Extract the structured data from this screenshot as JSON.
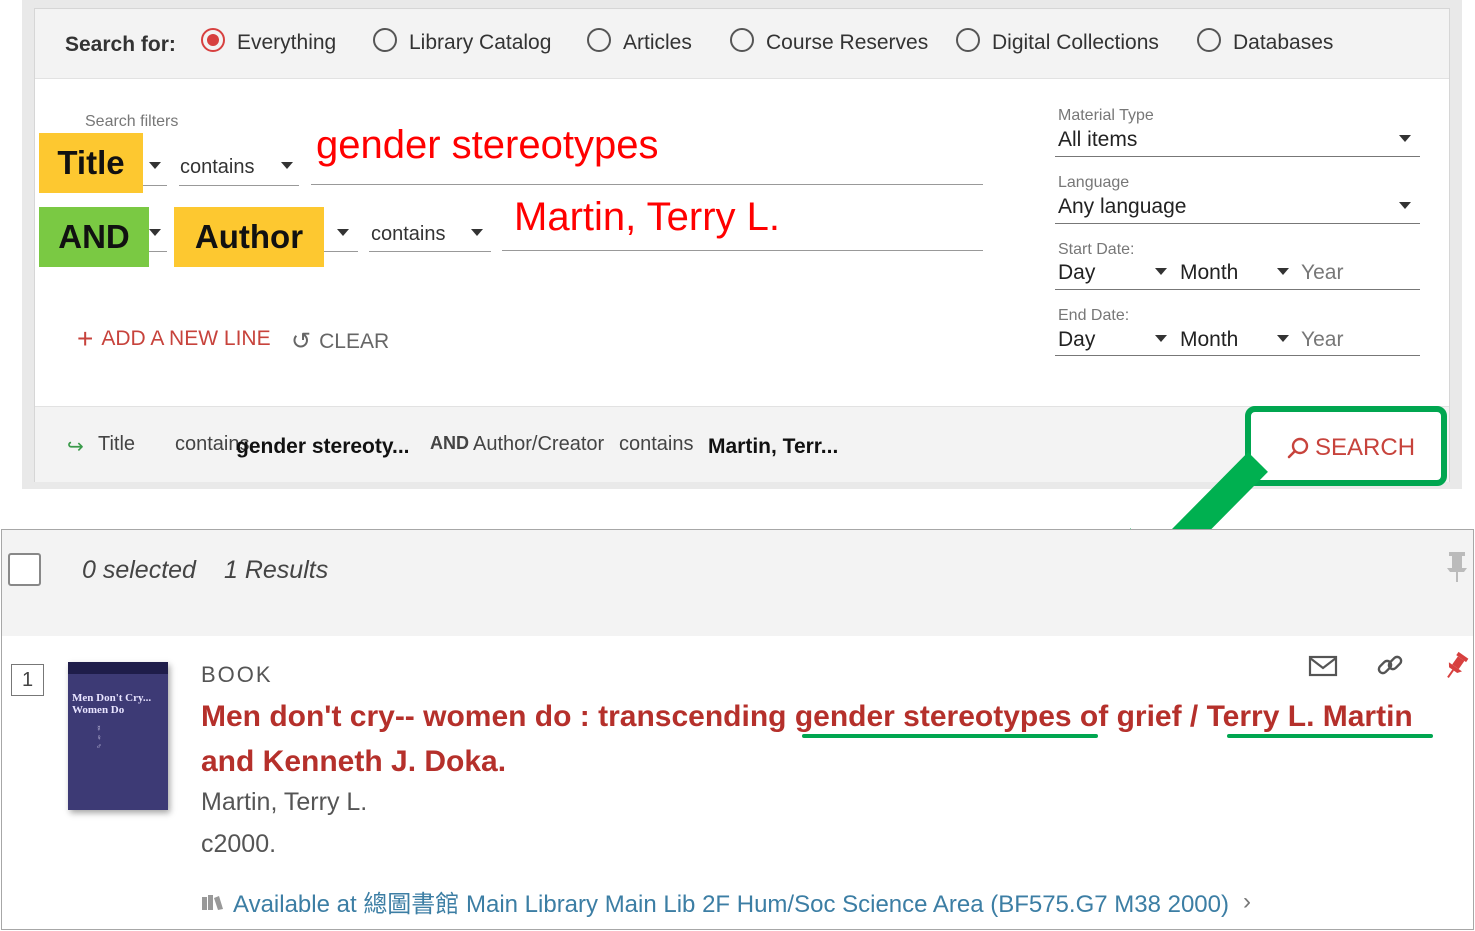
{
  "scope": {
    "label": "Search for:",
    "options": [
      {
        "label": "Everything",
        "selected": true
      },
      {
        "label": "Library Catalog",
        "selected": false
      },
      {
        "label": "Articles",
        "selected": false
      },
      {
        "label": "Course Reserves",
        "selected": false
      },
      {
        "label": "Digital Collections",
        "selected": false
      },
      {
        "label": "Databases",
        "selected": false
      }
    ]
  },
  "filters": {
    "hint": "Search filters",
    "line1": {
      "field": "Title",
      "operator": "contains",
      "term": "gender stereotypes"
    },
    "line2": {
      "boolean": "AND",
      "field": "Author",
      "operator": "contains",
      "term": "Martin, Terry L."
    }
  },
  "actions": {
    "add_line": "ADD A NEW LINE",
    "clear": "CLEAR"
  },
  "facets": {
    "material_type": {
      "label": "Material Type",
      "value": "All items"
    },
    "language": {
      "label": "Language",
      "value": "Any language"
    },
    "start_date": {
      "label": "Start Date:",
      "day": "Day",
      "month": "Month",
      "year": "Year"
    },
    "end_date": {
      "label": "End Date:",
      "day": "Day",
      "month": "Month",
      "year": "Year"
    }
  },
  "summary": {
    "arrow": "↪",
    "field1": "Title",
    "op1": "contains",
    "term1": "gender stereoty...",
    "boolean": "AND",
    "field2": "Author/Creator",
    "op2": "contains",
    "term2": "Martin, Terr..."
  },
  "search_button": "SEARCH",
  "results": {
    "selected": "0 selected",
    "count": "1 Results",
    "item": {
      "number": "1",
      "type": "BOOK",
      "title": "Men don't cry-- women do : transcending gender stereotypes of grief / Terry L. Martin and Kenneth J. Doka.",
      "author": "Martin, Terry L.",
      "date": "c2000.",
      "availability": "Available at 總圖書館 Main Library  Main Lib 2F Hum/Soc Science Area (BF575.G7 M38 2000)",
      "cover_title": "Men Don't Cry... Women Do"
    }
  },
  "colors": {
    "accent": "#c7433c",
    "highlight_yellow": "#fdc830",
    "highlight_green": "#7ac943",
    "annotation_green": "#00a650",
    "term_red": "#ff0000"
  }
}
